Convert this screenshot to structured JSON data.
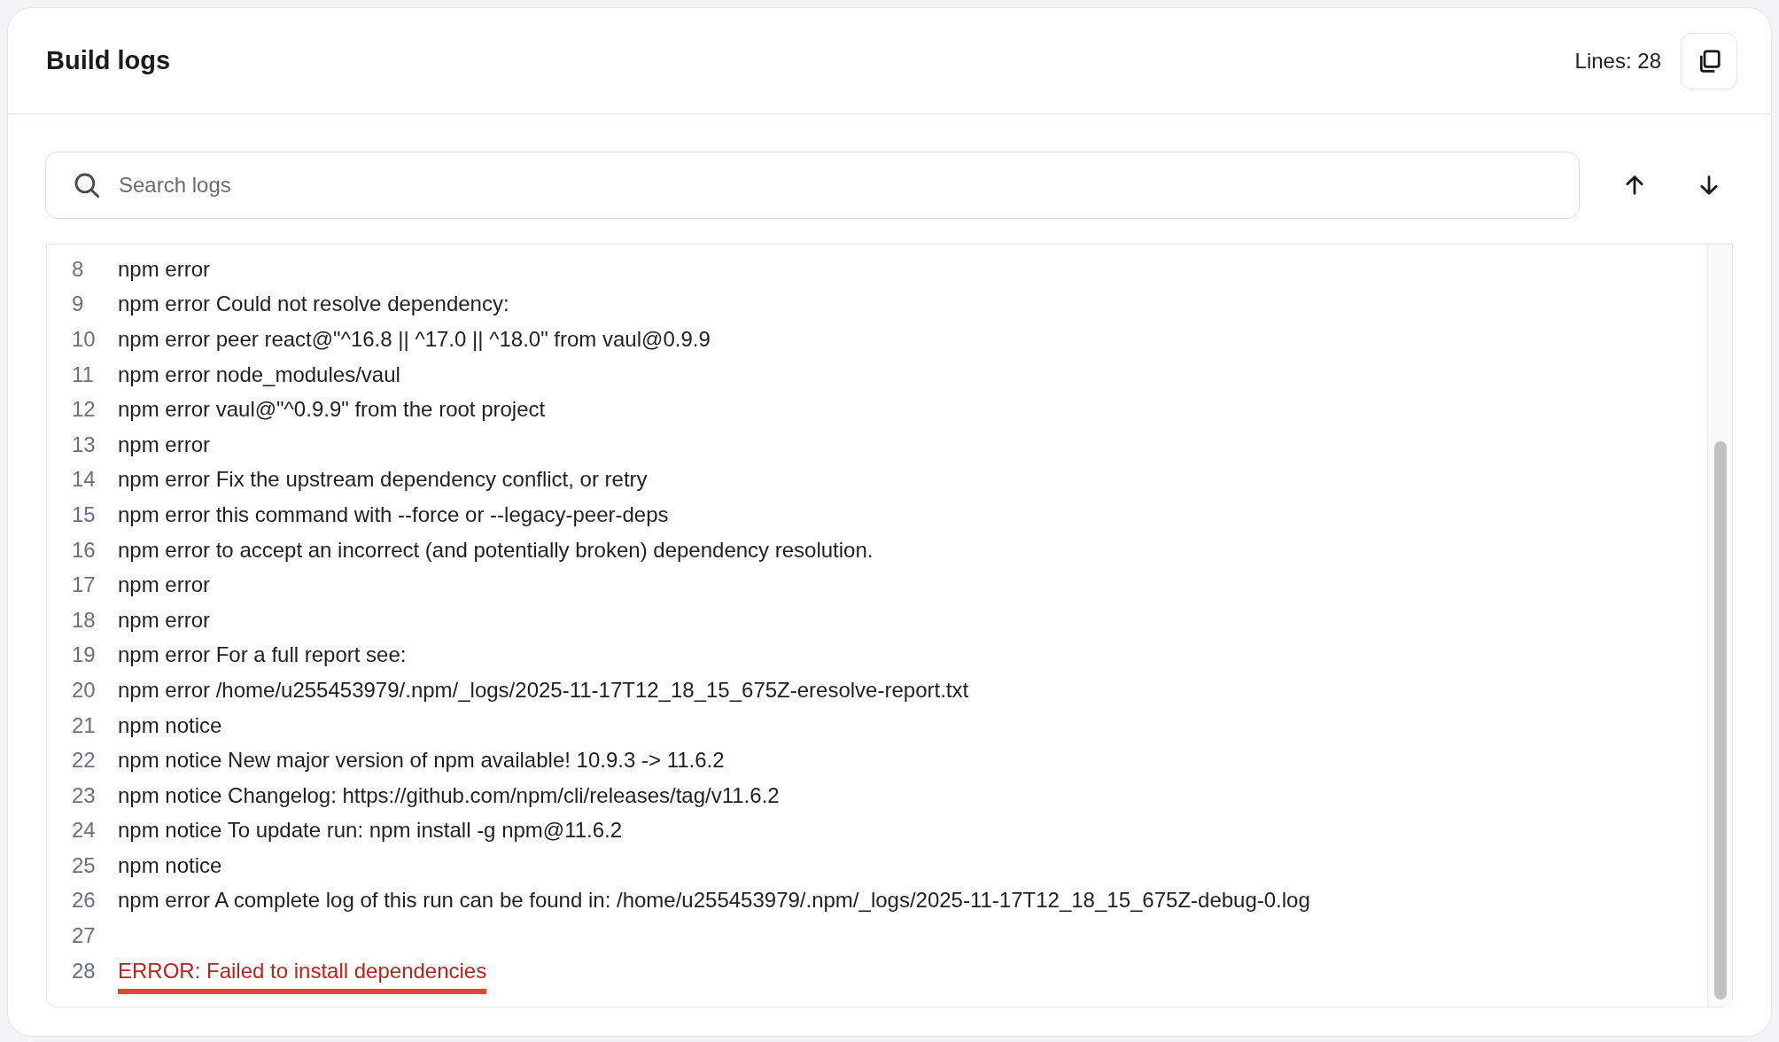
{
  "header": {
    "title": "Build logs",
    "line_count": "Lines: 28"
  },
  "search": {
    "placeholder": "Search logs"
  },
  "log_lines": [
    {
      "number": "8",
      "text": "npm error",
      "kind": "normal"
    },
    {
      "number": "9",
      "text": "npm error Could not resolve dependency:",
      "kind": "normal"
    },
    {
      "number": "10",
      "text": "npm error peer react@\"^16.8 || ^17.0 || ^18.0\" from vaul@0.9.9",
      "kind": "normal"
    },
    {
      "number": "11",
      "text": "npm error node_modules/vaul",
      "kind": "normal"
    },
    {
      "number": "12",
      "text": "npm error vaul@\"^0.9.9\" from the root project",
      "kind": "normal"
    },
    {
      "number": "13",
      "text": "npm error",
      "kind": "normal"
    },
    {
      "number": "14",
      "text": "npm error Fix the upstream dependency conflict, or retry",
      "kind": "normal"
    },
    {
      "number": "15",
      "text": "npm error this command with --force or --legacy-peer-deps",
      "kind": "normal"
    },
    {
      "number": "16",
      "text": "npm error to accept an incorrect (and potentially broken) dependency resolution.",
      "kind": "normal"
    },
    {
      "number": "17",
      "text": "npm error",
      "kind": "normal"
    },
    {
      "number": "18",
      "text": "npm error",
      "kind": "normal"
    },
    {
      "number": "19",
      "text": "npm error For a full report see:",
      "kind": "normal"
    },
    {
      "number": "20",
      "text": "npm error /home/u255453979/.npm/_logs/2025-11-17T12_18_15_675Z-eresolve-report.txt",
      "kind": "normal"
    },
    {
      "number": "21",
      "text": "npm notice",
      "kind": "normal"
    },
    {
      "number": "22",
      "text": "npm notice New major version of npm available! 10.9.3 -> 11.6.2",
      "kind": "normal"
    },
    {
      "number": "23",
      "text": "npm notice Changelog: https://github.com/npm/cli/releases/tag/v11.6.2",
      "kind": "normal"
    },
    {
      "number": "24",
      "text": "npm notice To update run: npm install -g npm@11.6.2",
      "kind": "normal"
    },
    {
      "number": "25",
      "text": "npm notice",
      "kind": "normal"
    },
    {
      "number": "26",
      "text": "npm error A complete log of this run can be found in: /home/u255453979/.npm/_logs/2025-11-17T12_18_15_675Z-debug-0.log",
      "kind": "normal"
    },
    {
      "number": "27",
      "kind": "normal"
    },
    {
      "number": "28",
      "text": "ERROR: Failed to install dependencies",
      "kind": "error"
    }
  ]
}
